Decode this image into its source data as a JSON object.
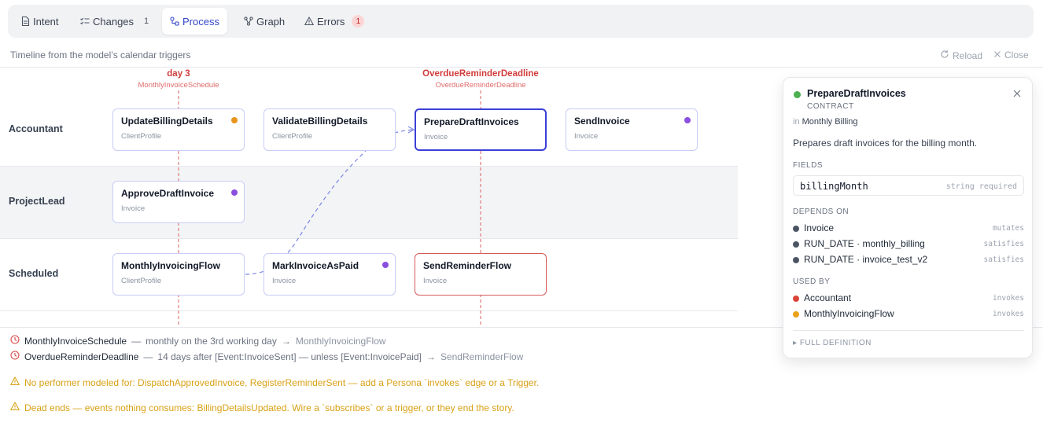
{
  "tabs": [
    {
      "label": "Intent",
      "icon": "document-icon"
    },
    {
      "label": "Changes",
      "icon": "checklist-icon",
      "count": "1"
    },
    {
      "label": "Process",
      "icon": "process-icon",
      "active": true
    },
    {
      "label": "Graph",
      "icon": "graph-icon"
    },
    {
      "label": "Errors",
      "icon": "warning-icon",
      "badge": "1"
    }
  ],
  "header": {
    "subtitle": "Timeline from the model’s calendar triggers",
    "reload_label": "Reload",
    "close_label": "Close"
  },
  "timeline": {
    "triggers": [
      {
        "title": "day 3",
        "subtitle": "MonthlyInvoiceSchedule"
      },
      {
        "title": "OverdueReminderDeadline",
        "subtitle": "OverdueReminderDeadline"
      }
    ],
    "lanes": [
      {
        "label": "Accountant"
      },
      {
        "label": "ProjectLead"
      },
      {
        "label": "Scheduled"
      }
    ],
    "nodes": [
      {
        "name": "UpdateBillingDetails",
        "type": "ClientProfile",
        "dot": "#e8941a"
      },
      {
        "name": "ValidateBillingDetails",
        "type": "ClientProfile"
      },
      {
        "name": "PrepareDraftInvoices",
        "type": "Invoice"
      },
      {
        "name": "SendInvoice",
        "type": "Invoice",
        "dot": "#8b4fe0"
      },
      {
        "name": "ApproveDraftInvoice",
        "type": "Invoice",
        "dot": "#8b4fe0"
      },
      {
        "name": "MonthlyInvoicingFlow",
        "type": "ClientProfile"
      },
      {
        "name": "MarkInvoiceAsPaid",
        "type": "Invoice",
        "dot": "#8b4fe0"
      },
      {
        "name": "SendReminderFlow",
        "type": "Invoice"
      }
    ]
  },
  "trigger_list": [
    {
      "name": "MonthlyInvoiceSchedule",
      "sep": "—",
      "desc": "monthly on the 3rd working day",
      "arrow": "→",
      "target": "MonthlyInvoicingFlow"
    },
    {
      "name": "OverdueReminderDeadline",
      "sep": "—",
      "desc": "14 days after [Event:InvoiceSent] — unless [Event:InvoicePaid]",
      "arrow": "→",
      "target": "SendReminderFlow"
    }
  ],
  "warnings": [
    "No performer modeled for: DispatchApprovedInvoice, RegisterReminderSent — add a Persona `invokes` edge or a Trigger.",
    "Dead ends — events nothing consumes: BillingDetailsUpdated. Wire a `subscribes` or a trigger, or they end the story."
  ],
  "panel": {
    "title": "PrepareDraftInvoices",
    "status_color": "#4caf50",
    "kind": "CONTRACT",
    "in_prefix": "in",
    "in_value": "Monthly Billing",
    "description": "Prepares draft invoices for the billing month.",
    "fields_heading": "FIELDS",
    "fields": [
      {
        "name": "billingMonth",
        "meta": "string required"
      }
    ],
    "depends_heading": "DEPENDS ON",
    "depends_on": [
      {
        "label": "Invoice",
        "rel": "mutates",
        "color": "#4b5563"
      },
      {
        "label": "RUN_DATE · monthly_billing",
        "rel": "satisfies",
        "color": "#4b5563"
      },
      {
        "label": "RUN_DATE · invoice_test_v2",
        "rel": "satisfies",
        "color": "#4b5563"
      }
    ],
    "used_heading": "USED BY",
    "used_by": [
      {
        "label": "Accountant",
        "rel": "invokes",
        "color": "#d9453b"
      },
      {
        "label": "MonthlyInvoicingFlow",
        "rel": "invokes",
        "color": "#e8a21a"
      }
    ],
    "full_definition": "FULL DEFINITION"
  },
  "colors": {
    "accent": "#3346c9",
    "danger": "#d23c3c",
    "warning": "#d9a116"
  }
}
